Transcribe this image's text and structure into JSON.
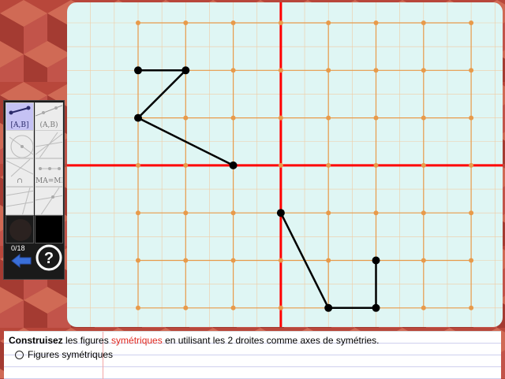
{
  "toolbar": {
    "segment_tool_label": "[A,B]",
    "line_tool_label": "(A,B)",
    "intersection_tool_label": "∩",
    "midpoint_tool_label": "MA=MB",
    "progress_counter": "0/18",
    "selected_color": "#2b2220",
    "secondary_color": "#000000"
  },
  "grid": {
    "columns": 7,
    "rows": 6,
    "axes_color": "#ff0000",
    "grid_color": "#e89a4a"
  },
  "figure": {
    "polyline_a": [
      [
        0,
        1
      ],
      [
        1,
        1
      ],
      [
        0,
        2
      ],
      [
        2,
        3
      ]
    ],
    "polyline_b": [
      [
        3,
        4
      ],
      [
        4,
        6
      ],
      [
        5,
        6
      ],
      [
        5,
        5
      ]
    ],
    "stroke_color": "#000000"
  },
  "instruction": {
    "bold_word": "Construisez",
    "text_before": " les figures ",
    "highlight": "symétriques",
    "text_after": " en utilisant les 2 droites comme axes de symétries.",
    "option_label": "Figures symétriques"
  },
  "colors": {
    "accent_red": "#e0281e",
    "background": "#b5483c"
  }
}
